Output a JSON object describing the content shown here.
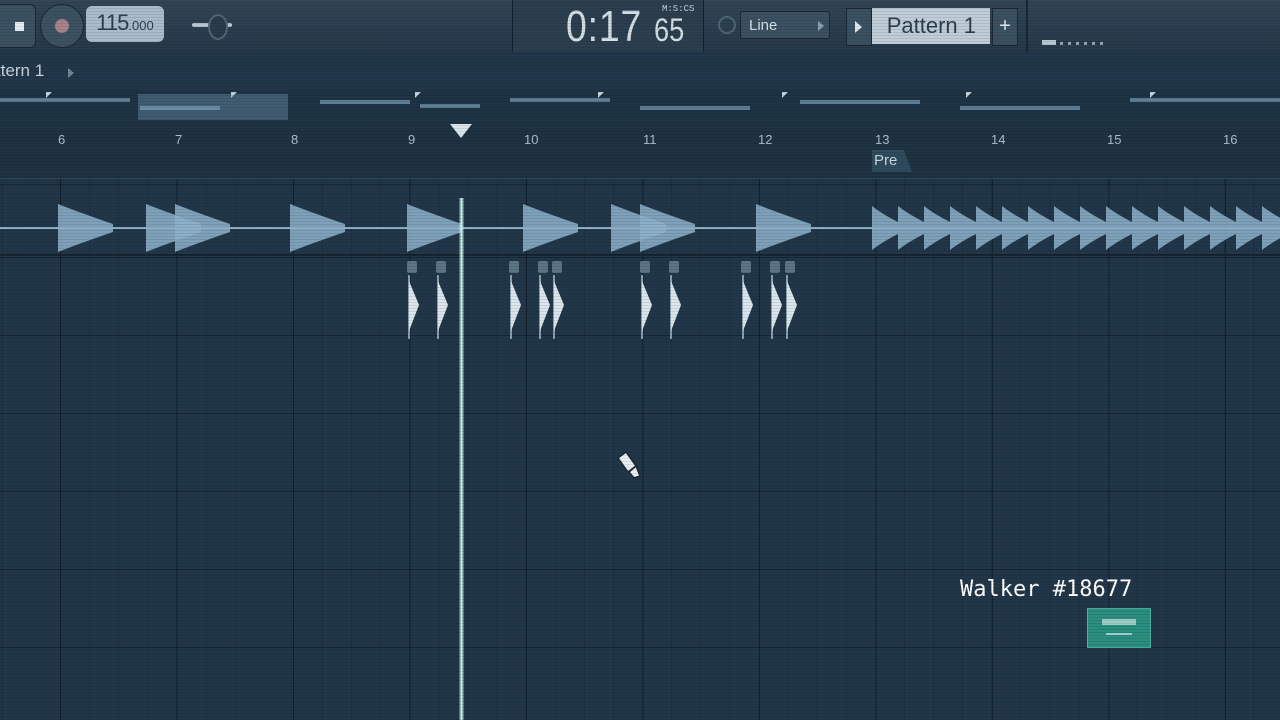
{
  "toolbar": {
    "tempo_int": "115",
    "tempo_frac": ".000",
    "time_main": "0:17",
    "time_sub": "65",
    "time_format": "M:S:CS",
    "snap_value": "Line",
    "pattern_name": "Pattern 1",
    "pattern_add": "+"
  },
  "header": {
    "pattern_label": "ttern 1"
  },
  "ruler": {
    "bars": [
      "6",
      "7",
      "8",
      "9",
      "10",
      "11",
      "12",
      "13",
      "14",
      "15",
      "16"
    ],
    "marker_label": "Pre"
  },
  "playlist": {
    "playhead_bar": 9.4
  },
  "watermark": {
    "text": "Walker #18677"
  },
  "colors": {
    "background": "#213749",
    "waveform": "#8fb3cc",
    "playhead": "#d9fff4",
    "watermark_logo": "#2a8e80"
  }
}
